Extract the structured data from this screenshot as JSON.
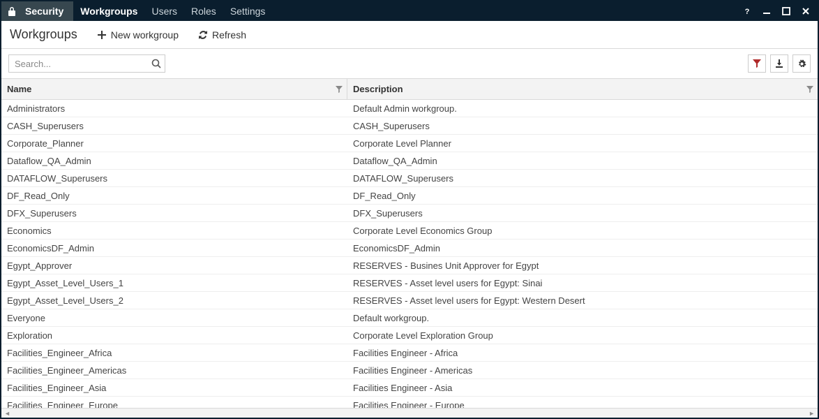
{
  "titlebar": {
    "section": "Security",
    "tabs": [
      "Workgroups",
      "Users",
      "Roles",
      "Settings"
    ],
    "active_tab": 0
  },
  "toolbar": {
    "page_title": "Workgroups",
    "new_label": "New workgroup",
    "refresh_label": "Refresh"
  },
  "search": {
    "placeholder": "Search..."
  },
  "table": {
    "columns": {
      "name": "Name",
      "description": "Description"
    },
    "rows": [
      {
        "name": "Administrators",
        "description": "Default Admin workgroup."
      },
      {
        "name": "CASH_Superusers",
        "description": "CASH_Superusers"
      },
      {
        "name": "Corporate_Planner",
        "description": "Corporate Level Planner"
      },
      {
        "name": "Dataflow_QA_Admin",
        "description": "Dataflow_QA_Admin"
      },
      {
        "name": "DATAFLOW_Superusers",
        "description": "DATAFLOW_Superusers"
      },
      {
        "name": "DF_Read_Only",
        "description": "DF_Read_Only"
      },
      {
        "name": "DFX_Superusers",
        "description": "DFX_Superusers"
      },
      {
        "name": "Economics",
        "description": "Corporate Level Economics Group"
      },
      {
        "name": "EconomicsDF_Admin",
        "description": "EconomicsDF_Admin"
      },
      {
        "name": "Egypt_Approver",
        "description": "RESERVES - Busines Unit Approver for Egypt"
      },
      {
        "name": "Egypt_Asset_Level_Users_1",
        "description": "RESERVES - Asset level users for Egypt: Sinai"
      },
      {
        "name": "Egypt_Asset_Level_Users_2",
        "description": "RESERVES - Asset level users for Egypt: Western Desert"
      },
      {
        "name": "Everyone",
        "description": "Default workgroup."
      },
      {
        "name": "Exploration",
        "description": "Corporate Level Exploration Group"
      },
      {
        "name": "Facilities_Engineer_Africa",
        "description": "Facilities Engineer - Africa"
      },
      {
        "name": "Facilities_Engineer_Americas",
        "description": "Facilities Engineer - Americas"
      },
      {
        "name": "Facilities_Engineer_Asia",
        "description": "Facilities Engineer - Asia"
      },
      {
        "name": "Facilities_Engineer_Europe",
        "description": "Facilities Engineer - Europe"
      }
    ]
  }
}
